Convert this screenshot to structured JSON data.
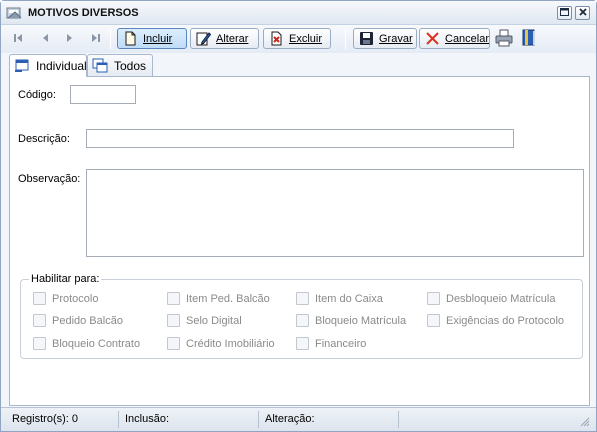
{
  "window": {
    "title": "MOTIVOS DIVERSOS",
    "icons": {
      "app": "app-window-icon",
      "maximize": "maximize-icon",
      "close": "close-icon"
    }
  },
  "toolbar": {
    "nav": [
      "first-record-icon",
      "previous-record-icon",
      "next-record-icon",
      "last-record-icon"
    ],
    "buttons": {
      "incluir": "Incluir",
      "alterar": "Alterar",
      "excluir": "Excluir",
      "gravar": "Gravar",
      "cancelar": "Cancelar"
    },
    "extra_icons": [
      "print-icon",
      "book-icon"
    ]
  },
  "tabs": [
    {
      "label": "Individual",
      "active": true
    },
    {
      "label": "Todos",
      "active": false
    }
  ],
  "form": {
    "codigo_label": "Código:",
    "codigo_value": "",
    "descricao_label": "Descrição:",
    "descricao_value": "",
    "observacao_label": "Observação:",
    "observacao_value": ""
  },
  "habilitar": {
    "legend": "Habilitar para:",
    "options": [
      "Protocolo",
      "Item Ped. Balcão",
      "Item do Caixa",
      "Desbloqueio Matrícula",
      "Pedido Balcão",
      "Selo Digital",
      "Bloqueio Matrícula",
      "Exigências do Protocolo",
      "Bloqueio Contrato",
      "Crédito Imobiliário",
      "Financeiro"
    ]
  },
  "status": {
    "registros": "Registro(s): 0",
    "inclusao": "Inclusão:",
    "alteracao": "Alteração:"
  },
  "colors": {
    "accent": "#5b86bd",
    "disabled_text": "#8a8a8a",
    "cancel_x": "#d9341e",
    "excluir_x": "#c8281a"
  }
}
